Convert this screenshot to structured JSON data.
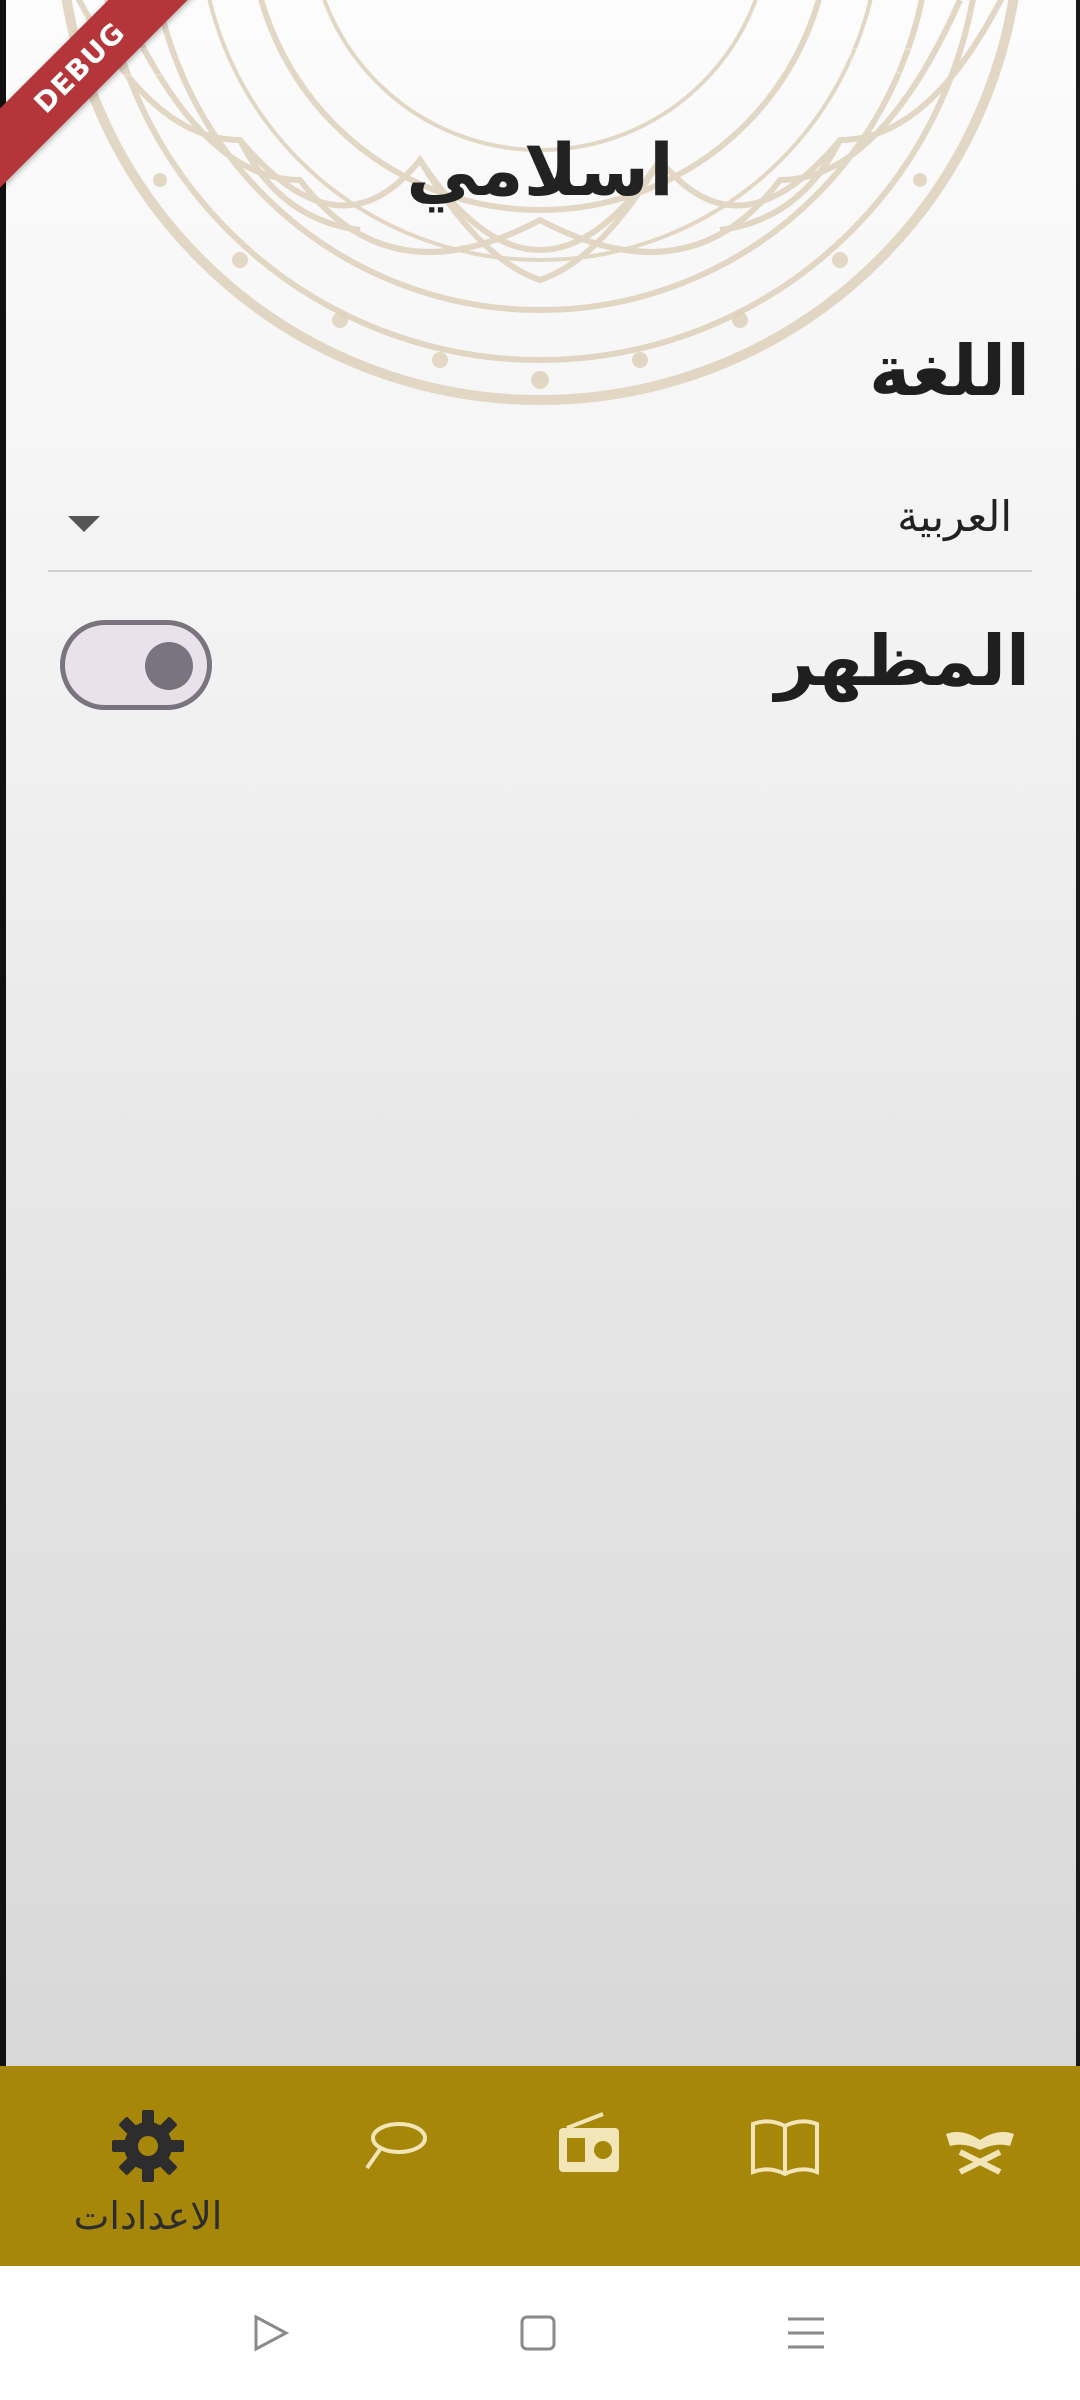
{
  "app": {
    "title": "اسلامي",
    "debug_banner": "DEBUG"
  },
  "settings": {
    "language_label": "اللغة",
    "language_value": "العربية",
    "theme_label": "المظهر",
    "theme_toggle_on": false
  },
  "bottom_nav": {
    "active_label": "الاعدادات",
    "items": [
      {
        "icon": "gear-icon",
        "label": "الاعدادات"
      },
      {
        "icon": "tasbeeh-icon",
        "label": ""
      },
      {
        "icon": "radio-icon",
        "label": ""
      },
      {
        "icon": "book-icon",
        "label": ""
      },
      {
        "icon": "quran-icon",
        "label": ""
      }
    ]
  },
  "colors": {
    "nav_background": "#a7870a",
    "active_icon": "#2d2d2d",
    "inactive_icon": "#f2e6b8",
    "toggle_track": "#e9e2ea",
    "toggle_outline": "#7a7380"
  }
}
